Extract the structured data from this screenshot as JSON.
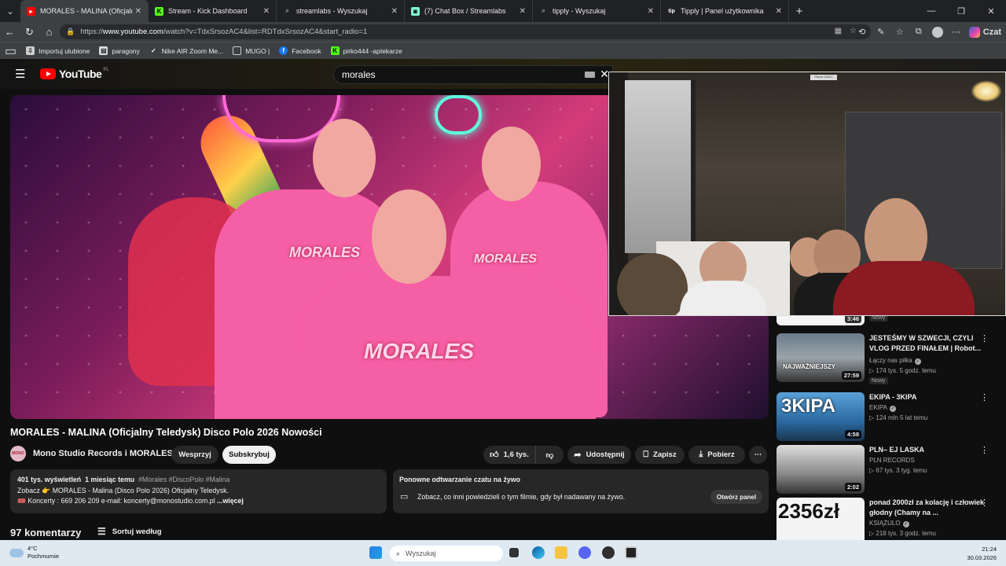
{
  "browser": {
    "tabs": [
      {
        "title": "MORALES - MALINA (Oficjalny Tel...",
        "icon": "youtube-icon",
        "color": "#ff0000"
      },
      {
        "title": "Stream - Kick Dashboard",
        "icon": "kick-icon",
        "color": "#53fc18"
      },
      {
        "title": "streamlabs - Wyszukaj",
        "icon": "search-icon",
        "color": "#9aa0a6"
      },
      {
        "title": "(7) Chat Box / Streamlabs",
        "icon": "streamlabs-icon",
        "color": "#80f5d2"
      },
      {
        "title": "tipply - Wyszukaj",
        "icon": "search-icon",
        "color": "#9aa0a6"
      },
      {
        "title": "Tipply | Panel użytkownika",
        "icon": "tipply-icon",
        "color": "#ffffff"
      }
    ],
    "url_prefix": "https://",
    "url_host": "www.youtube.com",
    "url_rest": "/watch?v=TdxSrsozAC4&list=RDTdxSrsozAC4&start_radio=1",
    "copilot_label": "Czat",
    "bookmarks": [
      {
        "label": "Importuj ulubione",
        "icon": "folder-import-icon"
      },
      {
        "label": "paragony",
        "icon": "receipt-icon"
      },
      {
        "label": "Nike AIR Zoom Me...",
        "icon": "nike-icon"
      },
      {
        "label": "MUGO |",
        "icon": "mugo-icon"
      },
      {
        "label": "Facebook",
        "icon": "facebook-icon"
      },
      {
        "label": "pirko444 -aptekarze",
        "icon": "kick-icon"
      }
    ]
  },
  "youtube": {
    "logo": "YouTube",
    "region": "PL",
    "search_value": "morales",
    "video": {
      "title": "MORALES - MALINA (Oficjalny Teledysk) Disco Polo 2026 Nowości",
      "channel": "Mono Studio Records i MORALES",
      "support_label": "Wesprzyj",
      "subscribe_label": "Subskrybuj",
      "likes": "1,6 tys.",
      "share_label": "Udostępnij",
      "save_label": "Zapisz",
      "download_label": "Pobierz",
      "hoodie_text": "MORALES"
    },
    "description": {
      "views": "401 tys. wyświetleń",
      "age": "1 miesiąc temu",
      "tags": "#Morales #DiscoPolo #Malina",
      "line2": "Zobacz 👉 MORALES - Malina (Disco Polo 2026) Oficjalny Teledysk.",
      "line3": "🎟️ Koncerty : 669 206 209 e-mail: koncerty@monostudio.com.pl",
      "more": "...więcej"
    },
    "chat_replay": {
      "title": "Ponowne odtwarzanie czatu na żywo",
      "desc": "Zobacz, co inni powiedzieli o tym filmie, gdy był nadawany na żywo.",
      "button": "Otwórz panel"
    },
    "comments": {
      "count": "97 komentarzy",
      "sort": "Sortuj według"
    },
    "sidebar": [
      {
        "duration": "3:46",
        "badge": "Nowy"
      },
      {
        "title": "JESTEŚMY W SZWECJI, CZYLI VLOG PRZED FINAŁEM | Robot...",
        "channel": "Łączy nas piłka",
        "meta": "▷ 174 tys.  5 godz. temu",
        "badge": "Nowy",
        "duration": "27:59",
        "thumb_text": "NAJWAŻNIEJSZY"
      },
      {
        "title": "EKIPA - 3KIPA",
        "channel": "EKIPA",
        "meta": "▷ 124 mln  5 lat temu",
        "duration": "4:58",
        "thumb_text": "3KIPA"
      },
      {
        "title": "PLN– EJ LASKA",
        "channel": "PLN RECORDS",
        "meta": "▷ 67 tys.  3 tyg. temu",
        "duration": "2:02"
      },
      {
        "title": "ponad 2000zł za kolację i człowiek głodny (Chamy na ...",
        "channel": "KSIĄŻULO",
        "meta": "▷ 218 tys.  3 godz. temu",
        "thumb_text": "2356zł"
      }
    ]
  },
  "pip": {
    "sign_text": "Phone 2W1C"
  },
  "taskbar": {
    "temp": "4°C",
    "weather": "Pochmurnie",
    "search_placeholder": "Wyszukaj",
    "time": "21:24",
    "date": "30.03.2026"
  }
}
